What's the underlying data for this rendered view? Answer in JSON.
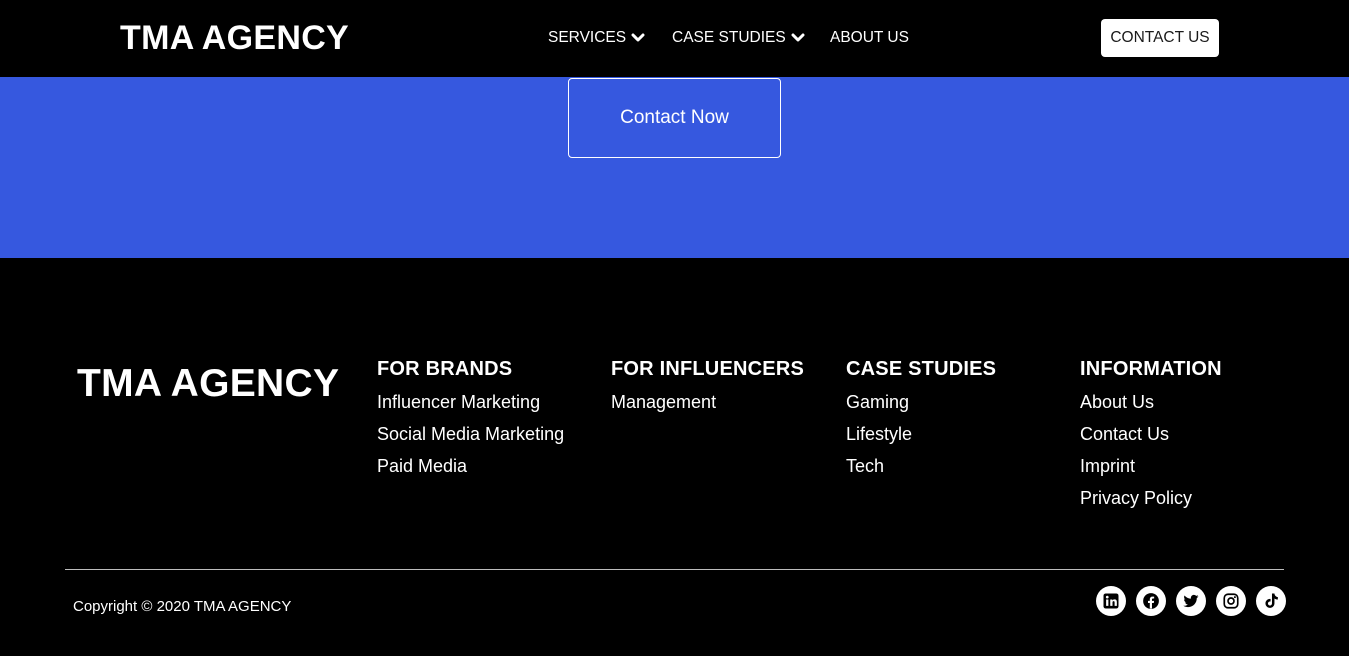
{
  "header": {
    "brand": "TMA AGENCY",
    "nav": {
      "services": "SERVICES",
      "case_studies": "CASE STUDIES",
      "about": "ABOUT US"
    },
    "contact_button": "CONTACT US"
  },
  "hero": {
    "background_color": "#3658df",
    "contact_now": "Contact Now"
  },
  "footer": {
    "brand": "TMA AGENCY",
    "columns": [
      {
        "title": "FOR BRANDS",
        "links": [
          "Influencer Marketing",
          "Social Media Marketing",
          "Paid Media"
        ]
      },
      {
        "title": "FOR INFLUENCERS",
        "links": [
          "Management"
        ]
      },
      {
        "title": "CASE STUDIES",
        "links": [
          "Gaming",
          "Lifestyle",
          "Tech"
        ]
      },
      {
        "title": "INFORMATION",
        "links": [
          "About Us",
          "Contact Us",
          "Imprint",
          "Privacy Policy"
        ]
      }
    ],
    "copyright": "Copyright © 2020 TMA AGENCY",
    "socials": [
      "linkedin-icon",
      "facebook-icon",
      "twitter-icon",
      "instagram-icon",
      "tiktok-icon"
    ]
  }
}
